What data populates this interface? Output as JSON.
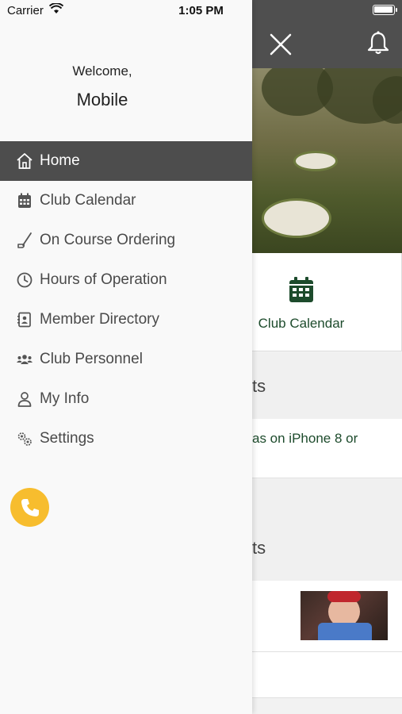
{
  "status_bar": {
    "carrier": "Carrier",
    "time": "1:05 PM",
    "battery_level": 1.0
  },
  "header": {
    "close_icon": "close-icon",
    "bell_icon": "bell-icon"
  },
  "background": {
    "tile_label": "Club Calendar",
    "section_1_fragment": "ts",
    "news_fragment": "as on iPhone 8 or",
    "section_2_fragment": "ts"
  },
  "drawer": {
    "welcome": "Welcome,",
    "username": "Mobile",
    "items": [
      {
        "label": "Home",
        "icon": "home-icon",
        "active": true
      },
      {
        "label": "Club Calendar",
        "icon": "calendar-icon",
        "active": false
      },
      {
        "label": "On Course Ordering",
        "icon": "golf-club-icon",
        "active": false
      },
      {
        "label": "Hours of Operation",
        "icon": "clock-icon",
        "active": false
      },
      {
        "label": "Member Directory",
        "icon": "contact-book-icon",
        "active": false
      },
      {
        "label": "Club Personnel",
        "icon": "group-icon",
        "active": false
      },
      {
        "label": "My Info",
        "icon": "user-icon",
        "active": false
      },
      {
        "label": "Settings",
        "icon": "gears-icon",
        "active": false
      }
    ],
    "phone_icon": "phone-icon"
  },
  "colors": {
    "accent_green": "#1d4b2c",
    "phone_yellow": "#f7bd2e",
    "active_item_bg": "#4d4d4d",
    "top_bar": "#4f4f4f"
  }
}
